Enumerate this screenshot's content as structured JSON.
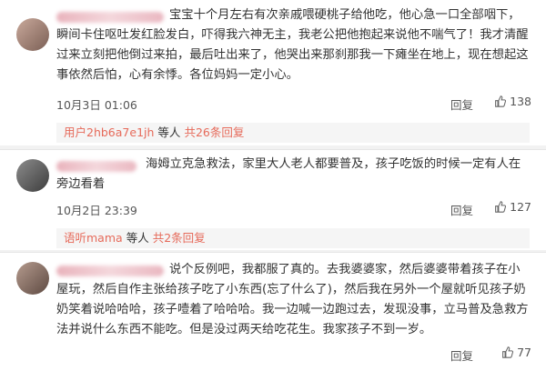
{
  "comments": [
    {
      "text": "宝宝十个月左右有次亲戚喂硬桃子给他吃，他心急一口全部咽下，瞬间卡住呕吐发红脸发白，吓得我六神无主，我老公把他抱起来说他不喘气了！我才清醒过来立刻把他倒过来拍，最后吐出来了，他哭出来那刹那我一下瘫坐在地上，现在想起这事依然后怕，心有余悸。各位妈妈一定小心。",
      "time": "10月3日 01:06",
      "reply_label": "回复",
      "likes": "138",
      "sub": {
        "user": "用户2hb6a7e1jh",
        "etc": "等人",
        "total": "共26条回复"
      }
    },
    {
      "text": "海姆立克急救法，家里大人老人都要普及，孩子吃饭的时候一定有人在旁边看着",
      "time": "10月2日 23:39",
      "reply_label": "回复",
      "likes": "127",
      "sub": {
        "user": "语听mama",
        "etc": "等人",
        "total": "共2条回复"
      }
    },
    {
      "text": "说个反例吧，我都服了真的。去我婆婆家，然后婆婆带着孩子在小屋玩，然后自作主张给孩子吃了小东西(忘了什么了)，然后我在另外一个屋就听见孩子奶奶笑着说哈哈哈，孩子噎着了哈哈哈。我一边喊一边跑过去，发现没事，立马普及急救方法并说什么东西不能吃。但是没过两天给吃花生。我家孩子不到一岁。",
      "reply_label": "回复",
      "likes": "77"
    }
  ],
  "colors": {
    "accent": "#e66a5a",
    "text": "#333333",
    "meta": "#555555"
  },
  "icons": {
    "like": "thumbs-up-icon"
  }
}
